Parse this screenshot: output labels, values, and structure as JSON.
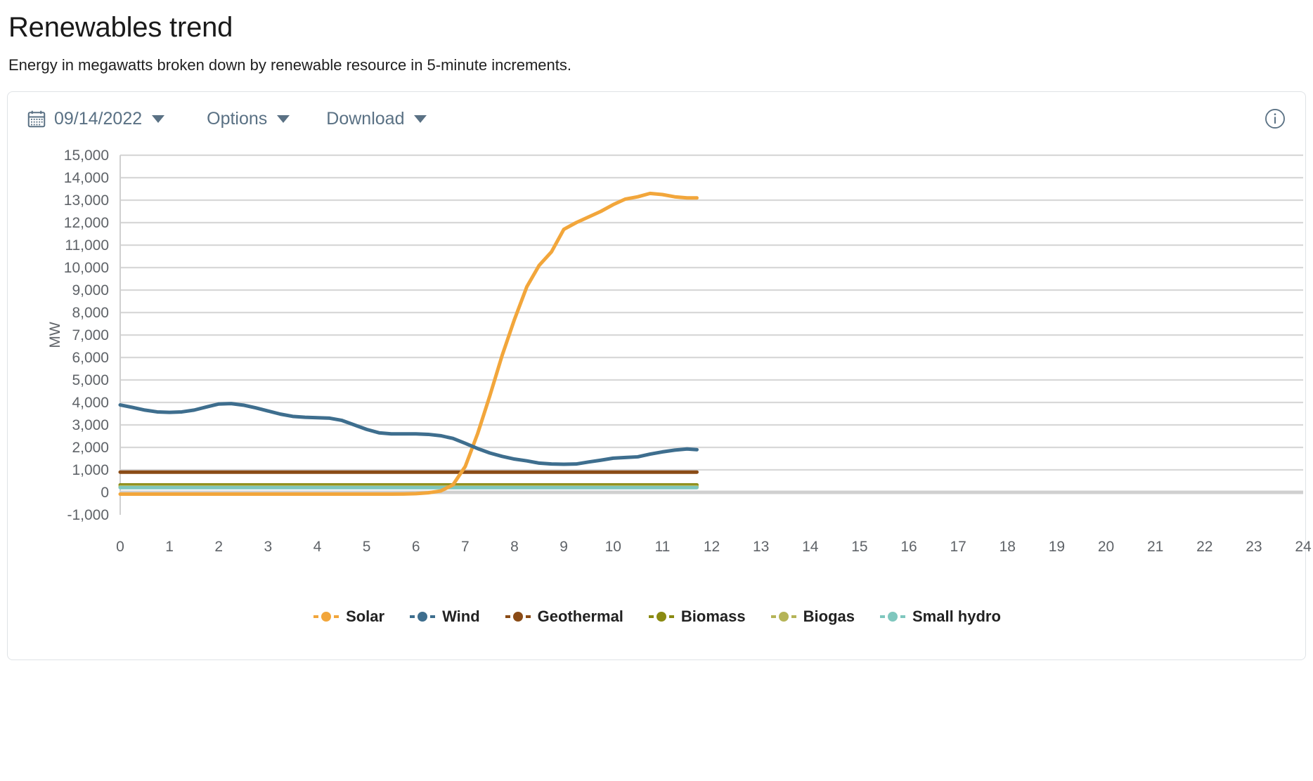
{
  "page": {
    "title": "Renewables trend",
    "subtitle": "Energy in megawatts broken down by renewable resource in 5-minute increments."
  },
  "toolbar": {
    "date_label": "09/14/2022",
    "date_icon": "calendar-icon",
    "options_label": "Options",
    "download_label": "Download",
    "info_icon": "info-circle-icon",
    "caret_icon": "caret-down-icon",
    "accent": "#5a7184"
  },
  "chart_data": {
    "type": "line",
    "title": "",
    "xlabel": "",
    "ylabel": "MW",
    "xlim": [
      0,
      24
    ],
    "ylim": [
      -1000,
      15000
    ],
    "ytick_step": 1000,
    "grid": true,
    "legend_position": "bottom",
    "xticks": [
      "0",
      "1",
      "2",
      "3",
      "4",
      "5",
      "6",
      "7",
      "8",
      "9",
      "10",
      "11",
      "12",
      "13",
      "14",
      "15",
      "16",
      "17",
      "18",
      "19",
      "20",
      "21",
      "22",
      "23",
      "24"
    ],
    "yticks": [
      "-1,000",
      "0",
      "1,000",
      "2,000",
      "3,000",
      "4,000",
      "5,000",
      "6,000",
      "7,000",
      "8,000",
      "9,000",
      "10,000",
      "11,000",
      "12,000",
      "13,000",
      "14,000",
      "15,000"
    ],
    "x": [
      0,
      0.25,
      0.5,
      0.75,
      1,
      1.25,
      1.5,
      1.75,
      2,
      2.25,
      2.5,
      2.75,
      3,
      3.25,
      3.5,
      3.75,
      4,
      4.25,
      4.5,
      4.75,
      5,
      5.25,
      5.5,
      5.75,
      6,
      6.25,
      6.5,
      6.75,
      7,
      7.25,
      7.5,
      7.75,
      8,
      8.25,
      8.5,
      8.75,
      9,
      9.25,
      9.5,
      9.75,
      10,
      10.25,
      10.5,
      10.75,
      11,
      11.25,
      11.5,
      11.7
    ],
    "series": [
      {
        "name": "Solar",
        "color": "#F2A63B",
        "values": [
          -80,
          -80,
          -80,
          -80,
          -80,
          -80,
          -80,
          -80,
          -80,
          -80,
          -80,
          -80,
          -80,
          -80,
          -80,
          -80,
          -80,
          -80,
          -80,
          -80,
          -80,
          -80,
          -80,
          -75,
          -60,
          -20,
          60,
          330,
          1150,
          2600,
          4300,
          6100,
          7700,
          9150,
          10100,
          10700,
          11700,
          12000,
          12250,
          12500,
          12800,
          13050,
          13150,
          13300,
          13250,
          13150,
          13100,
          13100
        ]
      },
      {
        "name": "Wind",
        "color": "#3E6E8E",
        "values": [
          3890,
          3780,
          3660,
          3580,
          3560,
          3580,
          3660,
          3800,
          3930,
          3950,
          3880,
          3760,
          3620,
          3480,
          3380,
          3340,
          3320,
          3300,
          3200,
          3000,
          2800,
          2650,
          2600,
          2600,
          2600,
          2580,
          2520,
          2400,
          2180,
          1950,
          1750,
          1600,
          1480,
          1400,
          1300,
          1260,
          1250,
          1260,
          1350,
          1430,
          1520,
          1550,
          1580,
          1700,
          1800,
          1880,
          1930,
          1900
        ]
      },
      {
        "name": "Geothermal",
        "color": "#8A4B16",
        "values": [
          900,
          900,
          900,
          900,
          900,
          900,
          900,
          900,
          900,
          900,
          900,
          900,
          900,
          900,
          900,
          900,
          900,
          900,
          900,
          900,
          900,
          900,
          900,
          900,
          900,
          900,
          900,
          900,
          900,
          900,
          900,
          900,
          900,
          900,
          900,
          900,
          900,
          900,
          900,
          900,
          900,
          900,
          900,
          900,
          900,
          900,
          900,
          900
        ]
      },
      {
        "name": "Biomass",
        "color": "#8A8A12",
        "values": [
          330,
          330,
          330,
          330,
          330,
          330,
          330,
          330,
          330,
          330,
          330,
          330,
          330,
          330,
          330,
          330,
          330,
          330,
          330,
          330,
          330,
          330,
          330,
          330,
          330,
          330,
          330,
          330,
          330,
          330,
          330,
          330,
          330,
          330,
          330,
          330,
          330,
          330,
          330,
          330,
          330,
          330,
          330,
          330,
          330,
          330,
          330,
          330
        ]
      },
      {
        "name": "Biogas",
        "color": "#B5B457",
        "values": [
          250,
          250,
          250,
          250,
          250,
          250,
          250,
          250,
          250,
          250,
          250,
          250,
          250,
          250,
          250,
          250,
          250,
          250,
          250,
          250,
          250,
          250,
          250,
          250,
          250,
          250,
          250,
          250,
          250,
          250,
          250,
          250,
          250,
          250,
          250,
          250,
          250,
          250,
          250,
          250,
          250,
          250,
          250,
          250,
          250,
          250,
          250,
          250
        ]
      },
      {
        "name": "Small hydro",
        "color": "#7FC7BE",
        "values": [
          210,
          210,
          210,
          210,
          210,
          210,
          210,
          210,
          210,
          210,
          210,
          210,
          210,
          210,
          210,
          210,
          210,
          210,
          210,
          210,
          210,
          210,
          210,
          210,
          210,
          210,
          210,
          210,
          210,
          210,
          210,
          210,
          210,
          210,
          210,
          210,
          210,
          210,
          210,
          210,
          210,
          210,
          210,
          210,
          210,
          210,
          210,
          210
        ]
      }
    ]
  }
}
